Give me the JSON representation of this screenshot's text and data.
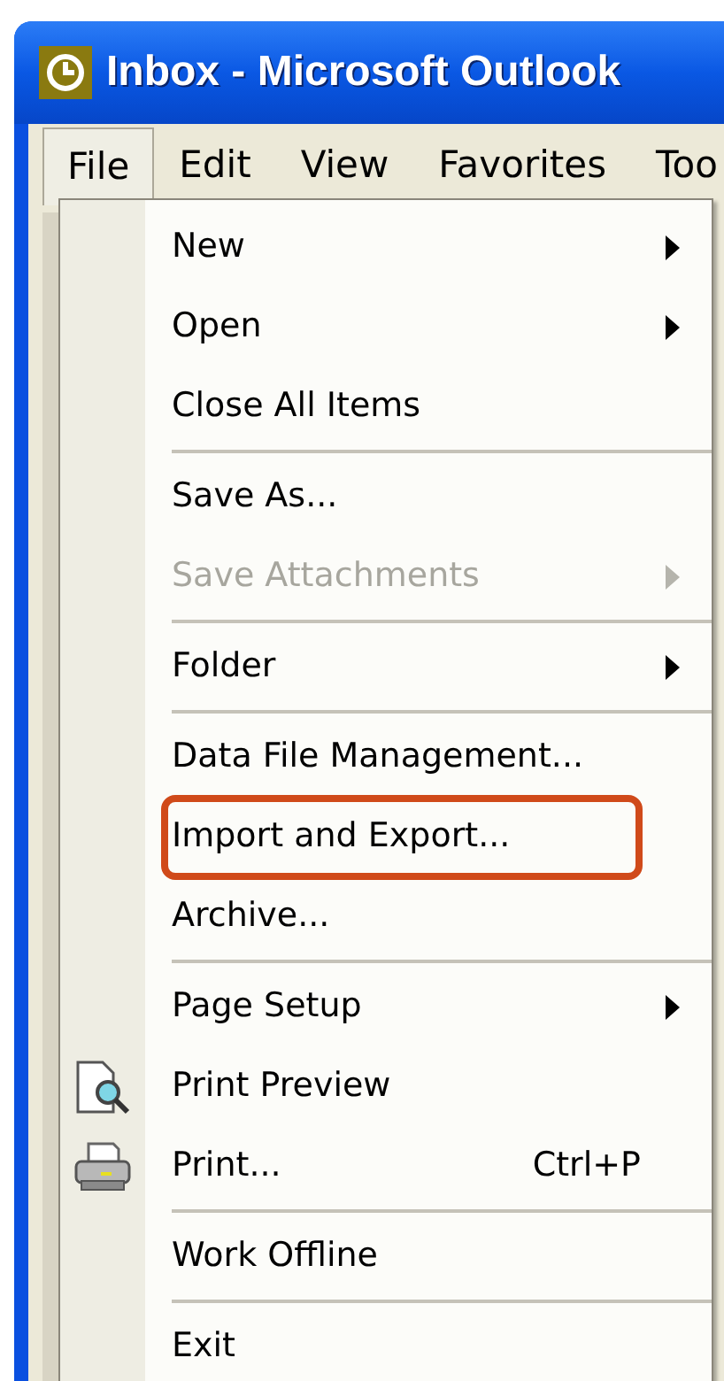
{
  "window": {
    "title": "Inbox - Microsoft Outlook"
  },
  "menu_bar": [
    {
      "label": "File",
      "selected": true
    },
    {
      "label": "Edit",
      "selected": false
    },
    {
      "label": "View",
      "selected": false
    },
    {
      "label": "Favorites",
      "selected": false
    },
    {
      "label": "Too",
      "selected": false
    }
  ],
  "file_menu": [
    {
      "kind": "item",
      "label": "New",
      "submenu": true,
      "disabled": false
    },
    {
      "kind": "item",
      "label": "Open",
      "submenu": true,
      "disabled": false
    },
    {
      "kind": "item",
      "label": "Close All Items",
      "submenu": false,
      "disabled": false
    },
    {
      "kind": "separator"
    },
    {
      "kind": "item",
      "label": "Save As...",
      "submenu": false,
      "disabled": false
    },
    {
      "kind": "item",
      "label": "Save Attachments",
      "submenu": true,
      "disabled": true
    },
    {
      "kind": "separator"
    },
    {
      "kind": "item",
      "label": "Folder",
      "submenu": true,
      "disabled": false
    },
    {
      "kind": "separator"
    },
    {
      "kind": "item",
      "label": "Data File Management...",
      "submenu": false,
      "disabled": false
    },
    {
      "kind": "item",
      "label": "Import and Export...",
      "submenu": false,
      "disabled": false,
      "annotated": true
    },
    {
      "kind": "item",
      "label": "Archive...",
      "submenu": false,
      "disabled": false
    },
    {
      "kind": "separator"
    },
    {
      "kind": "item",
      "label": "Page Setup",
      "submenu": true,
      "disabled": false
    },
    {
      "kind": "preview",
      "label": "Print Preview",
      "submenu": false,
      "disabled": false
    },
    {
      "kind": "print",
      "label": "Print...",
      "submenu": false,
      "disabled": false,
      "shortcut": "Ctrl+P"
    },
    {
      "kind": "separator"
    },
    {
      "kind": "item",
      "label": "Work Offline",
      "submenu": false,
      "disabled": false
    },
    {
      "kind": "separator"
    },
    {
      "kind": "item",
      "label": "Exit",
      "submenu": false,
      "disabled": false
    }
  ]
}
